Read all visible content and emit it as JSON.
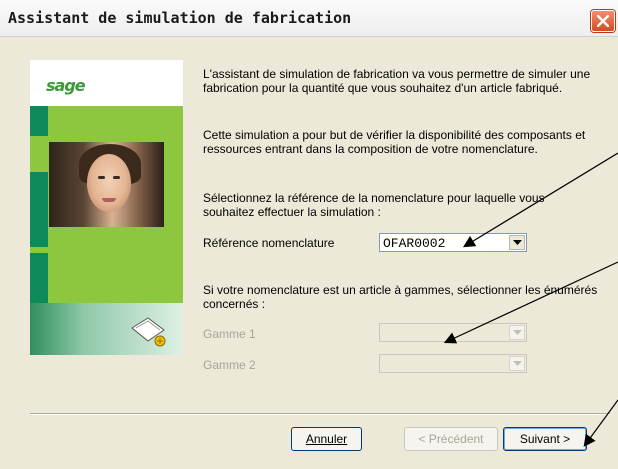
{
  "window": {
    "title": "Assistant de simulation de fabrication"
  },
  "brand": {
    "logo_text": "sage"
  },
  "intro": {
    "paragraph1": "L'assistant de simulation de fabrication va vous permettre de simuler une fabrication pour la quantité que vous souhaitez d'un article fabriqué.",
    "paragraph2": "Cette simulation a pour but de vérifier la disponibilité des composants et ressources entrant dans la composition de votre nomenclature.",
    "paragraph3": "Sélectionnez la référence de la nomenclature pour laquelle vous souhaitez effectuer la simulation :"
  },
  "reference": {
    "label": "Référence nomenclature",
    "value": "OFAR0002"
  },
  "gammes": {
    "instruction": "Si votre nomenclature est un article à gammes, sélectionner les énumérés concernés :",
    "gamme1_label": "Gamme 1",
    "gamme2_label": "Gamme 2",
    "gamme1_value": "",
    "gamme2_value": ""
  },
  "buttons": {
    "cancel": "Annuler",
    "previous": "< Précédent",
    "next": "Suivant >"
  },
  "colors": {
    "accent_green": "#3a9a3a",
    "close_red": "#d84a22",
    "dialog_bg": "#ece9d8"
  }
}
